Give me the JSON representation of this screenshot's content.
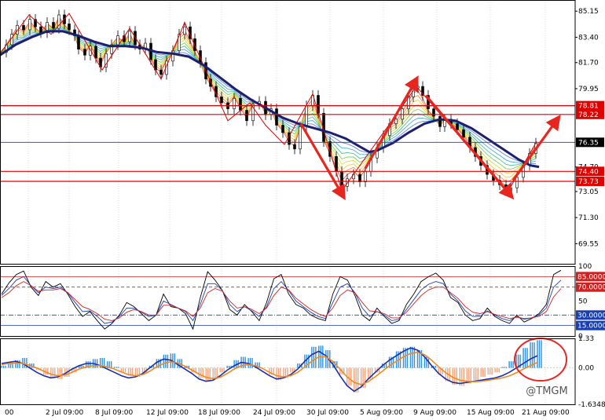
{
  "chart_data": [
    {
      "type": "line",
      "panel": "price",
      "ylim": [
        68.2,
        85.9
      ],
      "y_ticks": [
        "85.15",
        "83.40",
        "81.70",
        "79.95",
        "78.81",
        "78.22",
        "76.35",
        "74.70",
        "74.40",
        "73.73",
        "73.05",
        "71.30",
        "69.55"
      ],
      "price_series": [
        [
          0,
          82.4
        ],
        [
          8,
          82.9
        ],
        [
          15,
          83.6
        ],
        [
          22,
          84.2
        ],
        [
          30,
          83.9
        ],
        [
          38,
          84.6
        ],
        [
          45,
          84.1
        ],
        [
          52,
          83.7
        ],
        [
          60,
          84.4
        ],
        [
          68,
          84.0
        ],
        [
          75,
          84.9
        ],
        [
          82,
          84.3
        ],
        [
          88,
          83.9
        ],
        [
          95,
          83.5
        ],
        [
          100,
          82.6
        ],
        [
          108,
          82.2
        ],
        [
          115,
          82.8
        ],
        [
          122,
          82.0
        ],
        [
          128,
          81.4
        ],
        [
          135,
          82.3
        ],
        [
          142,
          82.9
        ],
        [
          150,
          83.5
        ],
        [
          158,
          83.1
        ],
        [
          165,
          83.8
        ],
        [
          172,
          82.9
        ],
        [
          178,
          82.6
        ],
        [
          185,
          83.0
        ],
        [
          192,
          81.9
        ],
        [
          198,
          81.2
        ],
        [
          205,
          80.9
        ],
        [
          212,
          81.8
        ],
        [
          220,
          82.5
        ],
        [
          228,
          83.6
        ],
        [
          235,
          84.1
        ],
        [
          242,
          83.3
        ],
        [
          248,
          82.5
        ],
        [
          255,
          81.7
        ],
        [
          262,
          80.6
        ],
        [
          268,
          80.1
        ],
        [
          275,
          79.4
        ],
        [
          282,
          79.0
        ],
        [
          290,
          78.6
        ],
        [
          298,
          79.3
        ],
        [
          306,
          78.5
        ],
        [
          314,
          77.8
        ],
        [
          322,
          78.9
        ],
        [
          330,
          79.1
        ],
        [
          338,
          78.2
        ],
        [
          345,
          78.6
        ],
        [
          352,
          77.5
        ],
        [
          360,
          77.0
        ],
        [
          368,
          76.2
        ],
        [
          375,
          75.9
        ],
        [
          382,
          77.4
        ],
        [
          390,
          78.8
        ],
        [
          398,
          79.5
        ],
        [
          405,
          78.3
        ],
        [
          412,
          76.4
        ],
        [
          420,
          75.4
        ],
        [
          428,
          74.4
        ],
        [
          435,
          73.4
        ],
        [
          442,
          73.9
        ],
        [
          450,
          74.2
        ],
        [
          458,
          73.7
        ],
        [
          465,
          74.4
        ],
        [
          472,
          75.3
        ],
        [
          480,
          76.0
        ],
        [
          488,
          76.8
        ],
        [
          496,
          77.6
        ],
        [
          504,
          77.9
        ],
        [
          512,
          78.6
        ],
        [
          520,
          79.4
        ],
        [
          526,
          80.0
        ],
        [
          532,
          80.1
        ],
        [
          538,
          79.5
        ],
        [
          545,
          78.6
        ],
        [
          552,
          78.1
        ],
        [
          560,
          77.4
        ],
        [
          566,
          77.9
        ],
        [
          574,
          77.6
        ],
        [
          582,
          77.2
        ],
        [
          590,
          76.7
        ],
        [
          598,
          76.0
        ],
        [
          605,
          75.4
        ],
        [
          612,
          74.8
        ],
        [
          620,
          74.2
        ],
        [
          628,
          73.8
        ],
        [
          636,
          73.5
        ],
        [
          644,
          73.1
        ],
        [
          650,
          73.3
        ],
        [
          658,
          74.0
        ],
        [
          666,
          74.8
        ],
        [
          674,
          75.6
        ],
        [
          682,
          76.3
        ]
      ],
      "ma_thick_series": [
        [
          0,
          82.2
        ],
        [
          20,
          82.9
        ],
        [
          40,
          83.4
        ],
        [
          60,
          83.8
        ],
        [
          80,
          83.8
        ],
        [
          100,
          83.5
        ],
        [
          120,
          83.1
        ],
        [
          140,
          82.8
        ],
        [
          160,
          82.8
        ],
        [
          180,
          82.7
        ],
        [
          200,
          82.4
        ],
        [
          220,
          82.3
        ],
        [
          240,
          82.1
        ],
        [
          260,
          81.5
        ],
        [
          280,
          80.7
        ],
        [
          300,
          79.9
        ],
        [
          320,
          79.2
        ],
        [
          340,
          78.6
        ],
        [
          360,
          78.0
        ],
        [
          380,
          77.6
        ],
        [
          400,
          77.3
        ],
        [
          420,
          77.0
        ],
        [
          440,
          76.6
        ],
        [
          460,
          76.0
        ],
        [
          470,
          75.7
        ],
        [
          480,
          75.8
        ],
        [
          500,
          76.3
        ],
        [
          520,
          77.0
        ],
        [
          540,
          77.6
        ],
        [
          560,
          77.9
        ],
        [
          580,
          77.8
        ],
        [
          600,
          77.3
        ],
        [
          620,
          76.6
        ],
        [
          640,
          75.9
        ],
        [
          660,
          75.2
        ],
        [
          675,
          74.8
        ],
        [
          686,
          74.7
        ]
      ],
      "horizontal_levels": [
        {
          "label": "78.81",
          "value": 78.81,
          "color": "#e00000"
        },
        {
          "label": "78.22",
          "value": 78.22,
          "color": "#e00000"
        },
        {
          "label": "76.35",
          "value": 76.35,
          "color": "#1a3fb5"
        },
        {
          "label": "74.40",
          "value": 74.4,
          "color": "#e00000"
        },
        {
          "label": "73.73",
          "value": 73.73,
          "color": "#e00000"
        }
      ],
      "current_price_label": "76.35",
      "arrows": [
        {
          "from": [
            383,
            77.6
          ],
          "to": [
            435,
            72.9
          ]
        },
        {
          "from": [
            465,
            74.6
          ],
          "to": [
            528,
            80.4
          ]
        },
        {
          "from": [
            542,
            79.5
          ],
          "to": [
            648,
            72.9
          ]
        },
        {
          "from": [
            653,
            73.8
          ],
          "to": [
            708,
            77.8
          ]
        }
      ],
      "zigzag_points": [
        [
          0,
          82.3
        ],
        [
          37,
          84.9
        ],
        [
          65,
          83.6
        ],
        [
          88,
          85.0
        ],
        [
          130,
          81.2
        ],
        [
          165,
          84.0
        ],
        [
          205,
          80.6
        ],
        [
          235,
          84.4
        ],
        [
          290,
          77.8
        ],
        [
          318,
          79.0
        ],
        [
          338,
          77.5
        ],
        [
          362,
          76.2
        ],
        [
          398,
          79.6
        ],
        [
          435,
          73.1
        ],
        [
          530,
          80.1
        ],
        [
          646,
          73.0
        ],
        [
          683,
          76.4
        ]
      ]
    },
    {
      "type": "line",
      "panel": "stochastic",
      "ylim": [
        0,
        100
      ],
      "levels": [
        {
          "label": "85.0000",
          "value": 85,
          "style": "solid"
        },
        {
          "label": "70.0000",
          "value": 70,
          "style": "dashed"
        },
        {
          "label": "30.0000",
          "value": 30,
          "style": "dashdot"
        },
        {
          "label": "15.0000",
          "value": 15,
          "style": "solid"
        }
      ],
      "y_ticks": [
        "100",
        "50",
        "0"
      ],
      "series": [
        {
          "color": "#000000",
          "values": [
            60,
            76,
            88,
            93,
            70,
            58,
            78,
            70,
            75,
            60,
            42,
            28,
            35,
            22,
            10,
            18,
            30,
            48,
            42,
            32,
            22,
            30,
            60,
            42,
            40,
            32,
            10,
            55,
            92,
            80,
            65,
            38,
            30,
            45,
            35,
            22,
            48,
            82,
            88,
            60,
            45,
            40,
            30,
            25,
            22,
            60,
            85,
            80,
            58,
            30,
            22,
            40,
            28,
            18,
            22,
            45,
            60,
            78,
            85,
            90,
            80,
            55,
            48,
            30,
            22,
            25,
            40,
            28,
            22,
            18,
            30,
            20,
            25,
            32,
            45,
            88,
            94
          ]
        },
        {
          "color": "#1a3fb5",
          "values": [
            58,
            68,
            80,
            85,
            72,
            62,
            70,
            68,
            70,
            62,
            48,
            35,
            36,
            28,
            18,
            20,
            28,
            40,
            40,
            34,
            28,
            30,
            50,
            45,
            40,
            35,
            22,
            45,
            75,
            75,
            65,
            45,
            35,
            42,
            36,
            28,
            42,
            68,
            78,
            65,
            50,
            42,
            34,
            28,
            25,
            48,
            70,
            75,
            62,
            40,
            28,
            35,
            30,
            22,
            24,
            38,
            52,
            66,
            74,
            78,
            75,
            60,
            50,
            36,
            28,
            28,
            36,
            30,
            25,
            22,
            28,
            24,
            26,
            30,
            40,
            70,
            80
          ]
        },
        {
          "color": "#d02020",
          "values": [
            55,
            62,
            72,
            78,
            72,
            64,
            66,
            66,
            68,
            62,
            52,
            42,
            38,
            32,
            24,
            22,
            26,
            34,
            38,
            35,
            30,
            30,
            44,
            44,
            40,
            36,
            28,
            40,
            62,
            68,
            64,
            50,
            40,
            42,
            38,
            32,
            40,
            58,
            70,
            66,
            54,
            46,
            38,
            32,
            28,
            40,
            58,
            66,
            62,
            48,
            36,
            35,
            32,
            26,
            26,
            34,
            46,
            58,
            66,
            70,
            70,
            62,
            54,
            42,
            34,
            32,
            35,
            31,
            28,
            25,
            27,
            25,
            26,
            28,
            35,
            56,
            68
          ]
        }
      ]
    },
    {
      "type": "bar",
      "panel": "macd",
      "ylim": [
        -1.6348,
        1.33
      ],
      "y_ticks": [
        "1.33",
        "0.00",
        "-1.6348"
      ],
      "histogram": [
        0.1,
        0.2,
        0.35,
        0.45,
        0.2,
        -0.1,
        -0.3,
        -0.45,
        -0.5,
        -0.4,
        -0.2,
        0.1,
        0.3,
        0.4,
        0.45,
        0.3,
        0.05,
        -0.2,
        -0.35,
        -0.4,
        -0.25,
        0.1,
        0.4,
        0.6,
        0.65,
        0.4,
        0.1,
        -0.2,
        -0.45,
        -0.6,
        -0.5,
        -0.2,
        0.1,
        0.35,
        0.5,
        0.45,
        0.25,
        0.0,
        -0.3,
        -0.55,
        -0.45,
        -0.2,
        0.2,
        0.6,
        0.95,
        1.0,
        0.8,
        0.3,
        -0.3,
        -0.8,
        -1.1,
        -0.9,
        -0.5,
        -0.2,
        0.2,
        0.5,
        0.75,
        0.9,
        0.95,
        0.8,
        0.5,
        0.1,
        -0.3,
        -0.6,
        -0.75,
        -0.8,
        -0.7,
        -0.55,
        -0.4,
        -0.3,
        -0.2,
        0.05,
        0.3,
        0.6,
        0.9,
        1.15,
        1.25
      ],
      "series": [
        {
          "color": "#1a2fb0",
          "values": [
            0.2,
            0.25,
            0.3,
            0.2,
            0.0,
            -0.2,
            -0.35,
            -0.45,
            -0.4,
            -0.25,
            -0.05,
            0.1,
            0.2,
            0.2,
            0.1,
            -0.05,
            -0.2,
            -0.35,
            -0.45,
            -0.4,
            -0.25,
            0.0,
            0.25,
            0.4,
            0.35,
            0.15,
            -0.05,
            -0.25,
            -0.5,
            -0.6,
            -0.55,
            -0.35,
            -0.1,
            0.1,
            0.25,
            0.2,
            0.05,
            -0.15,
            -0.35,
            -0.5,
            -0.45,
            -0.3,
            -0.05,
            0.3,
            0.6,
            0.75,
            0.55,
            0.15,
            -0.35,
            -0.8,
            -1.05,
            -0.85,
            -0.5,
            -0.2,
            0.1,
            0.35,
            0.55,
            0.75,
            0.9,
            0.8,
            0.5,
            0.1,
            -0.25,
            -0.5,
            -0.65,
            -0.7,
            -0.65,
            -0.6,
            -0.55,
            -0.5,
            -0.45,
            -0.35,
            -0.2,
            0.0,
            0.2,
            0.4,
            0.55
          ]
        },
        {
          "color": "#f08a1c",
          "values": [
            0.15,
            0.2,
            0.22,
            0.2,
            0.12,
            0.0,
            -0.15,
            -0.28,
            -0.35,
            -0.32,
            -0.2,
            -0.05,
            0.05,
            0.1,
            0.1,
            0.05,
            -0.05,
            -0.18,
            -0.3,
            -0.35,
            -0.3,
            -0.15,
            0.05,
            0.2,
            0.28,
            0.22,
            0.08,
            -0.1,
            -0.28,
            -0.42,
            -0.48,
            -0.42,
            -0.25,
            -0.05,
            0.1,
            0.15,
            0.1,
            -0.02,
            -0.2,
            -0.35,
            -0.4,
            -0.35,
            -0.2,
            0.05,
            0.3,
            0.5,
            0.5,
            0.3,
            -0.05,
            -0.4,
            -0.65,
            -0.75,
            -0.62,
            -0.4,
            -0.15,
            0.1,
            0.3,
            0.5,
            0.65,
            0.7,
            0.6,
            0.35,
            0.05,
            -0.22,
            -0.42,
            -0.55,
            -0.6,
            -0.62,
            -0.6,
            -0.56,
            -0.5,
            -0.45,
            -0.36,
            -0.22,
            -0.05,
            0.1,
            0.25
          ]
        }
      ]
    }
  ],
  "x_axis": {
    "labels": [
      "00",
      "2 Jul 09:00",
      "8 Jul 09:00",
      "12 Jul 09:00",
      "18 Jul 09:00",
      "24 Jul 09:00",
      "30 Jul 09:00",
      "5 Aug 09:00",
      "9 Aug 09:00",
      "15 Aug 09:00",
      "21 Aug 09:00"
    ]
  },
  "watermark": "@TMGM",
  "colors": {
    "level_red": "#e00000",
    "level_blue": "#1a3fb5",
    "macd_pos": "#2f8fe0",
    "macd_neg": "#f5a27a",
    "arrow": "#e8251f"
  }
}
